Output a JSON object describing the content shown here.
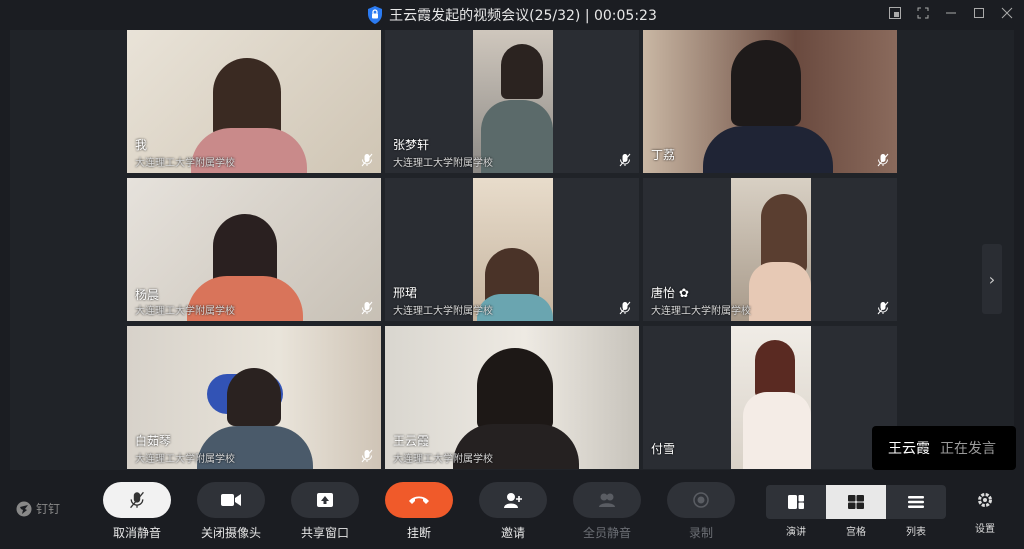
{
  "window": {
    "title": "王云霞发起的视频会议(25/32) | 00:05:23"
  },
  "tiles": [
    {
      "name": "我",
      "org": "大连理工大学附属学校"
    },
    {
      "name": "张梦轩",
      "org": "大连理工大学附属学校"
    },
    {
      "name": "丁荔",
      "org": ""
    },
    {
      "name": "杨晨",
      "org": "大连理工大学附属学校"
    },
    {
      "name": "邢珺",
      "org": "大连理工大学附属学校"
    },
    {
      "name": "唐怡 ✿",
      "org": "大连理工大学附属学校"
    },
    {
      "name": "白茹琴",
      "org": "大连理工大学附属学校"
    },
    {
      "name": "王云霞",
      "org": "大连理工大学附属学校"
    },
    {
      "name": "付雪",
      "org": ""
    }
  ],
  "speaking": {
    "name": "王云霞",
    "status": "正在发言"
  },
  "brand": "钉钉",
  "toolbar": {
    "unmute": "取消静音",
    "camera_off": "关闭摄像头",
    "share": "共享窗口",
    "hangup": "挂断",
    "invite": "邀请",
    "mute_all": "全员静音",
    "record": "录制",
    "layout_speaker": "演讲",
    "layout_grid": "宫格",
    "layout_list": "列表",
    "settings": "设置"
  },
  "colors": {
    "active_border": "#25a85a",
    "hangup": "#f05a2a",
    "stage_bg": "#202328"
  }
}
